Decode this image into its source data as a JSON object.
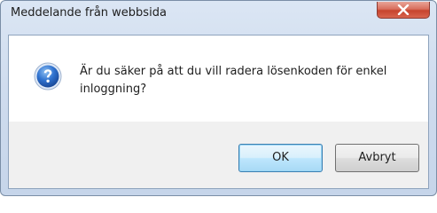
{
  "window": {
    "title": "Meddelande från webbsida"
  },
  "dialog": {
    "icon": "question-icon",
    "message": "Är du säker på att du vill radera lösenkoden för enkel inloggning?"
  },
  "buttons": {
    "ok_label": "OK",
    "cancel_label": "Avbryt"
  },
  "colors": {
    "close_button": "#c7442e",
    "icon_blue": "#1f5fb8",
    "default_button_border": "#3c7fb1"
  }
}
